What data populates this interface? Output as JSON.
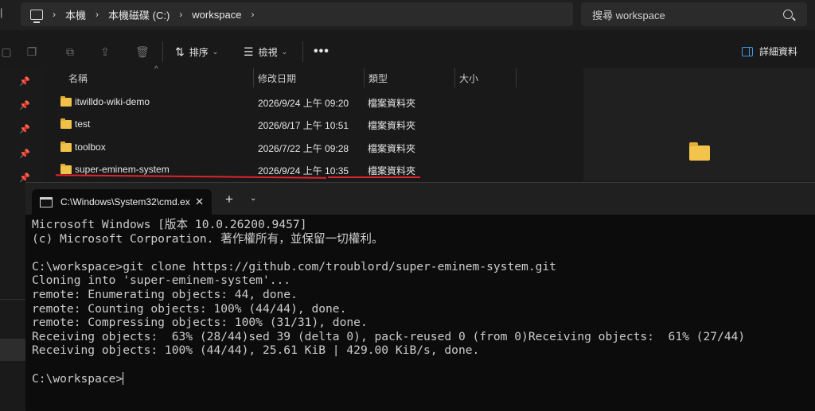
{
  "address_bar": {
    "crumbs": [
      "本機",
      "本機磁碟 (C:)",
      "workspace"
    ],
    "left_edge_char": "|"
  },
  "search": {
    "placeholder": "搜尋 workspace"
  },
  "toolbar": {
    "sort_label": "排序",
    "view_label": "檢視",
    "more_label": "•••",
    "details_label": "詳細資料"
  },
  "columns": {
    "name": "名稱",
    "date": "修改日期",
    "type": "類型",
    "size": "大小"
  },
  "files": [
    {
      "name": "itwilldo-wiki-demo",
      "date": "2026/9/24 上午 09:20",
      "type": "檔案資料夾"
    },
    {
      "name": "test",
      "date": "2026/8/17 上午 10:51",
      "type": "檔案資料夾"
    },
    {
      "name": "toolbox",
      "date": "2026/7/22 上午 09:28",
      "type": "檔案資料夾"
    },
    {
      "name": "super-eminem-system",
      "date": "2026/9/24 上午 10:35",
      "type": "檔案資料夾"
    }
  ],
  "terminal": {
    "tab_title": "C:\\Windows\\System32\\cmd.ex",
    "lines": [
      "Microsoft Windows [版本 10.0.26200.9457]",
      "(c) Microsoft Corporation. 著作權所有，並保留一切權利。",
      "",
      "C:\\workspace>git clone https://github.com/troublord/super-eminem-system.git",
      "Cloning into 'super-eminem-system'...",
      "remote: Enumerating objects: 44, done.",
      "remote: Counting objects: 100% (44/44), done.",
      "remote: Compressing objects: 100% (31/31), done.",
      "Receiving objects:  63% (28/44)sed 39 (delta 0), pack-reused 0 (from 0)Receiving objects:  61% (27/44)",
      "Receiving objects: 100% (44/44), 25.61 KiB | 429.00 KiB/s, done.",
      "",
      "C:\\workspace>"
    ]
  },
  "colors": {
    "highlight_underline": "#e0242c",
    "folder": "#f0c24a",
    "accent": "#3c9cf0"
  }
}
